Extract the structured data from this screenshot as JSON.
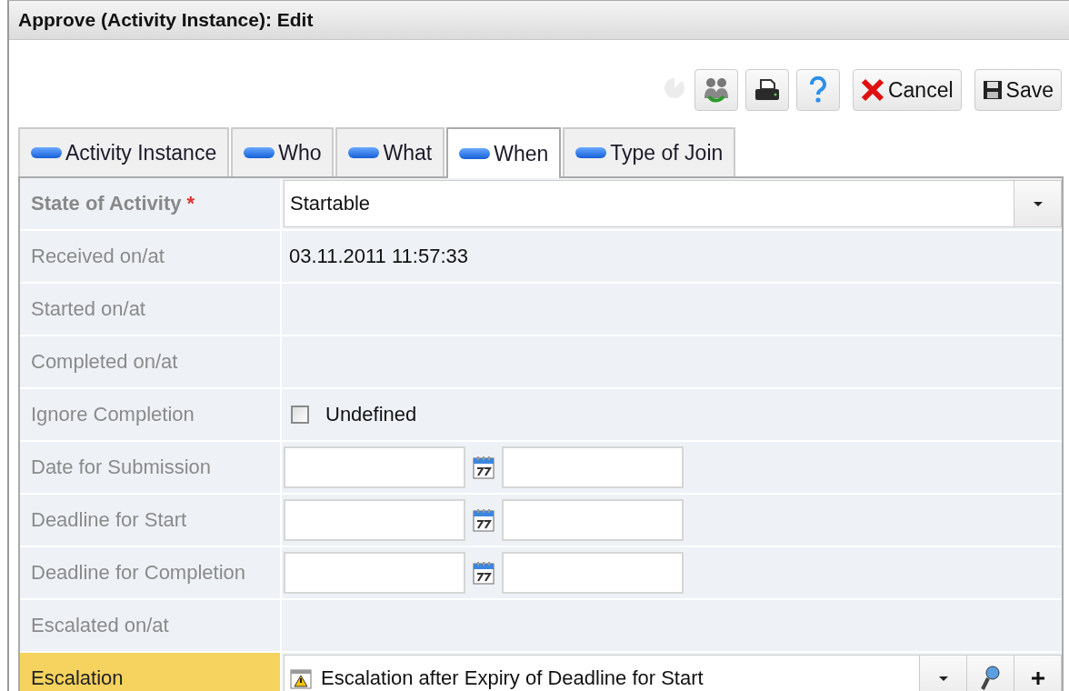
{
  "window": {
    "title": "Approve (Activity Instance): Edit"
  },
  "toolbar": {
    "buttons": [
      {
        "kind": "busy"
      },
      {
        "kind": "people"
      },
      {
        "kind": "print"
      },
      {
        "kind": "help"
      },
      {
        "kind": "cancel",
        "label": "Cancel"
      },
      {
        "kind": "save",
        "label": "Save"
      }
    ]
  },
  "tabs": [
    {
      "label": "Activity Instance",
      "selected": false
    },
    {
      "label": "Who",
      "selected": false
    },
    {
      "label": "What",
      "selected": false
    },
    {
      "label": "When",
      "selected": true
    },
    {
      "label": "Type of Join",
      "selected": false
    }
  ],
  "fields": [
    {
      "kind": "select",
      "label": "State of Activity",
      "required_mark": "*",
      "value": "Startable",
      "highlighted": false
    },
    {
      "kind": "text",
      "label": "Received on/at",
      "value": "03.11.2011 11:57:33",
      "highlighted": false
    },
    {
      "kind": "text",
      "label": "Started on/at",
      "highlighted": false
    },
    {
      "kind": "text",
      "label": "Completed on/at",
      "highlighted": false
    },
    {
      "kind": "checkbox",
      "label": "Ignore Completion",
      "checked": false,
      "option": "Undefined",
      "highlighted": false
    },
    {
      "kind": "datetime",
      "label": "Date for Submission",
      "highlighted": false
    },
    {
      "kind": "datetime",
      "label": "Deadline for Start",
      "highlighted": false
    },
    {
      "kind": "datetime",
      "label": "Deadline for Completion",
      "highlighted": false
    },
    {
      "kind": "text",
      "label": "Escalated on/at",
      "highlighted": false
    },
    {
      "kind": "lookup",
      "label": "Escalation",
      "value": "Escalation after Expiry of Deadline for Start",
      "highlighted": true
    }
  ]
}
